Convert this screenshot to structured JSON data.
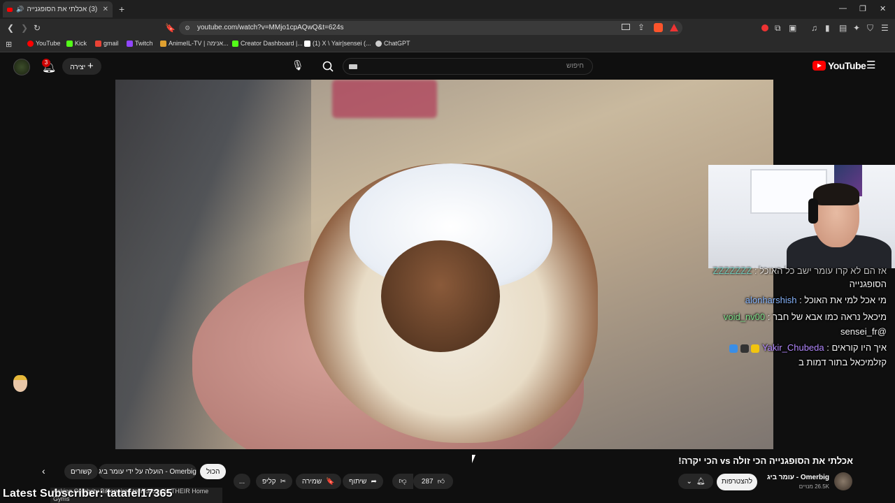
{
  "browser": {
    "tab_title": "(3) אכלתי את הסופגנייה הכי",
    "url": "youtube.com/watch?v=MMjo1cpAQwQ&t=624s",
    "bookmarks": [
      {
        "label": "YouTube",
        "color": "#ff0000"
      },
      {
        "label": "Kick",
        "color": "#53fc18"
      },
      {
        "label": "gmail",
        "color": "#ea4335"
      },
      {
        "label": "Twitch",
        "color": "#9146ff"
      },
      {
        "label": "AnimeIL-TV | אנימה...",
        "color": "#e0a030"
      },
      {
        "label": "Creator Dashboard |...",
        "color": "#53fc18"
      },
      {
        "label": "(1) X \\ Yair|sensei (...",
        "color": "#ffffff"
      },
      {
        "label": "ChatGPT",
        "color": "#cccccc"
      }
    ]
  },
  "youtube": {
    "logo_text": "YouTube",
    "search_placeholder": "חיפוש",
    "create_label": "יצירה",
    "notification_count": "3"
  },
  "chat": {
    "lines": [
      {
        "user": "ZZZZZZZ",
        "text": "אז הם לא קרו עומר ישב כל האוכל"
      },
      {
        "user": "",
        "text": "הסופגנייה"
      },
      {
        "user": "alonharshish",
        "text": "מי אכל למי את האוכל"
      },
      {
        "user": "void_nv00",
        "text": "מיכאל נראה כמו אבא של חבר"
      },
      {
        "user": "",
        "text": "@sensei_fr"
      },
      {
        "user": "Yakir_Chubeda",
        "text": "איך היו קוראים"
      },
      {
        "user": "",
        "text": "קזלמיכאל בתור דמות ב"
      }
    ]
  },
  "video": {
    "title": "אכלתי את הסופגנייה הכי זולה vs הכי יקרה!",
    "channel_name": "עומר ביג - Omerbig",
    "subscriber_count": "26.5K מנויים",
    "subscribe_label": "להצטרפות",
    "like_count": "287",
    "share_label": "שיתוף",
    "save_label": "שמירה",
    "clip_label": "קליפ",
    "more_label": "..."
  },
  "filters": {
    "all": "הכול",
    "uploaded_by": "הועלה על ידי עומר ביג - Omerbig",
    "related": "קשורים"
  },
  "stream_overlay": {
    "latest_subscriber": "Latest Subscriber: tatafel17365",
    "ticker_text": "Asking Celebrity Billionaires to Workout in THEIR Home Gyms"
  }
}
